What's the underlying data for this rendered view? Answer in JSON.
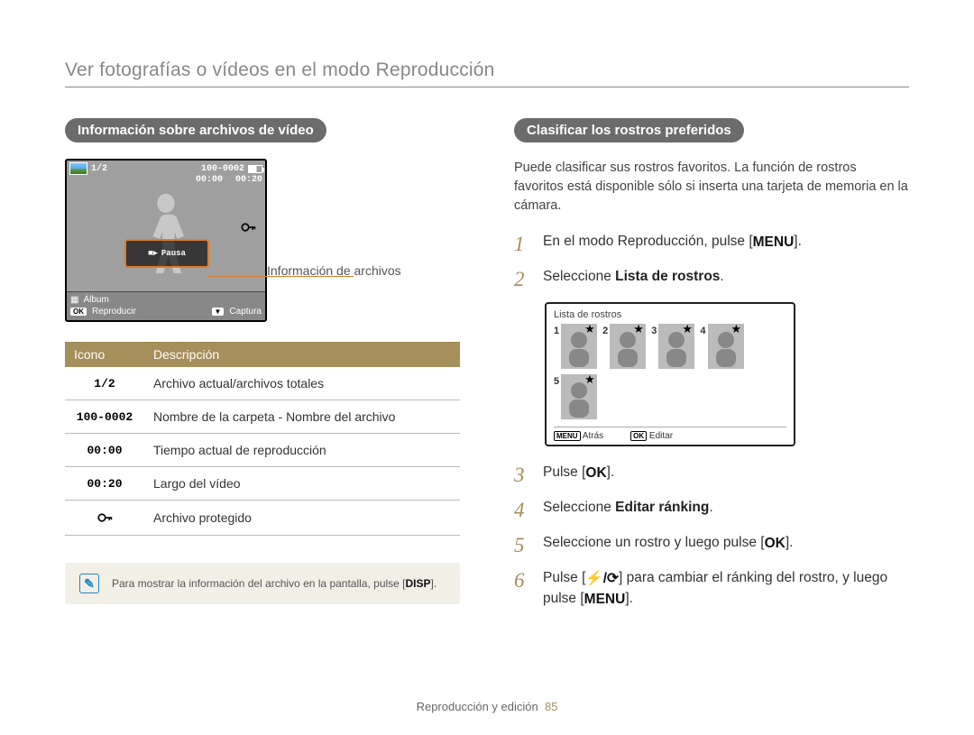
{
  "page_title": "Ver fotografías o vídeos en el modo Reproducción",
  "left": {
    "heading": "Información sobre archivos de vídeo",
    "callout": "Información de archivos",
    "screen": {
      "counter": "1/2",
      "folder_file": "100-0002",
      "time_cur": "00:00",
      "time_len": "00:20",
      "album_icon_label": "Álbum",
      "ok_label": "Reproducir",
      "capture_label": "Captura",
      "clip_label": "Pausa"
    },
    "table": {
      "head_icon": "Icono",
      "head_desc": "Descripción",
      "rows": [
        {
          "icon": "1/2",
          "desc": "Archivo actual/archivos totales"
        },
        {
          "icon": "100-0002",
          "desc": "Nombre de la carpeta - Nombre del archivo"
        },
        {
          "icon": "00:00",
          "desc": "Tiempo actual de reproducción"
        },
        {
          "icon": "00:20",
          "desc": "Largo del vídeo"
        },
        {
          "icon": "key",
          "desc": "Archivo protegido"
        }
      ]
    },
    "note": {
      "text_pre": "Para mostrar la información del archivo en la pantalla, pulse [",
      "button": "DISP",
      "text_post": "]."
    }
  },
  "right": {
    "heading": "Clasificar los rostros preferidos",
    "intro": "Puede clasificar sus rostros favoritos. La función de rostros favoritos está disponible sólo si inserta una tarjeta de memoria en la cámara.",
    "steps": {
      "s1_pre": "En el modo Reproducción, pulse [",
      "s1_btn": "MENU",
      "s1_post": "].",
      "s2_pre": "Seleccione ",
      "s2_bold": "Lista de rostros",
      "s2_post": ".",
      "s3_pre": "Pulse [",
      "s3_btn": "OK",
      "s3_post": "].",
      "s4_pre": "Seleccione ",
      "s4_bold": "Editar ránking",
      "s4_post": ".",
      "s5_pre": "Seleccione un rostro y luego pulse [",
      "s5_btn": "OK",
      "s5_post": "].",
      "s6_pre": "Pulse [",
      "s6_icons": "⚡/⟳",
      "s6_mid": "] para cambiar el ránking del rostro, y luego pulse [",
      "s6_btn": "MENU",
      "s6_post": "]."
    },
    "faces": {
      "title": "Lista de rostros",
      "nums": [
        "1",
        "2",
        "3",
        "4",
        "5"
      ],
      "back_btn": "MENU",
      "back_label": "Atrás",
      "edit_btn": "OK",
      "edit_label": "Editar"
    }
  },
  "footer": {
    "section": "Reproducción y edición",
    "page": "85"
  }
}
